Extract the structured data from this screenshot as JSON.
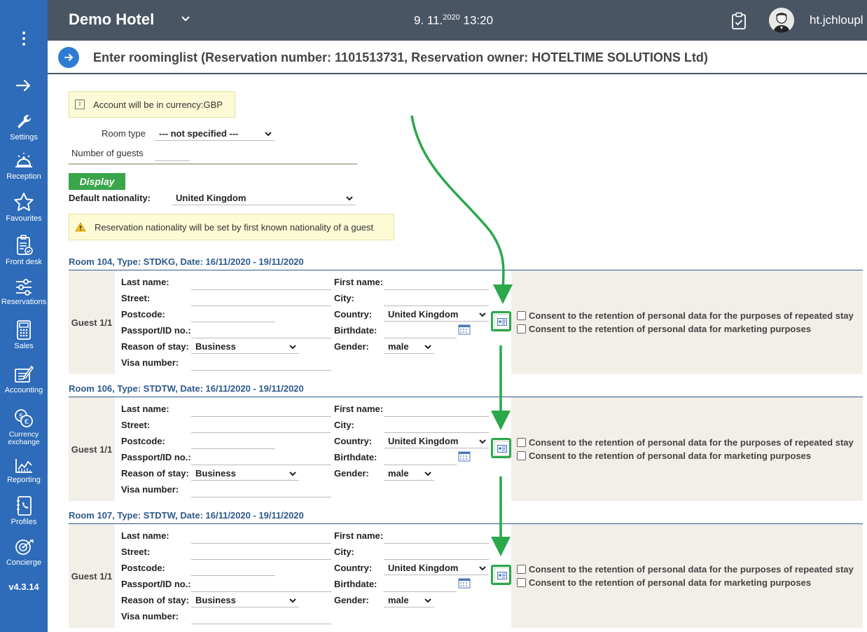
{
  "app": {
    "version": "v4.3.14"
  },
  "sidebar": {
    "items": [
      {
        "label": "Settings",
        "icon": "wrench-icon"
      },
      {
        "label": "Reception",
        "icon": "bell-icon"
      },
      {
        "label": "Favourites",
        "icon": "star-icon"
      },
      {
        "label": "Front desk",
        "icon": "clipboard-icon"
      },
      {
        "label": "Reservations",
        "icon": "sliders-icon"
      },
      {
        "label": "Sales",
        "icon": "calculator-icon"
      },
      {
        "label": "Accounting",
        "icon": "accounting-icon"
      },
      {
        "label": "Currency\nexchange",
        "icon": "currency-icon"
      },
      {
        "label": "Reporting",
        "icon": "chart-icon"
      },
      {
        "label": "Profiles",
        "icon": "phonebook-icon"
      },
      {
        "label": "Concierge",
        "icon": "concierge-icon"
      }
    ]
  },
  "header": {
    "hotel": "Demo Hotel",
    "date": "9. 11.",
    "year": "2020",
    "time": "13:20",
    "user": "ht.jchloupl"
  },
  "page": {
    "title": "Enter roominglist (Reservation number: 1101513731, Reservation owner: HOTELTIME SOLUTIONS Ltd)",
    "currency_note": "Account will be in currency:GBP",
    "room_type_label": "Room type",
    "room_type_value": "--- not specified ---",
    "guests_label": "Number of guests",
    "display_button": "Display",
    "default_nationality_label": "Default nationality:",
    "default_nationality_value": "United Kingdom",
    "nationality_warning": "Reservation nationality will be set by first known nationality of a guest"
  },
  "labels": {
    "last_name": "Last name:",
    "street": "Street:",
    "postcode": "Postcode:",
    "passport": "Passport/ID no.:",
    "reason": "Reason of stay:",
    "visa": "Visa number:",
    "first_name": "First name:",
    "city": "City:",
    "country": "Country:",
    "birthdate": "Birthdate:",
    "gender": "Gender:",
    "consent_repeated": "Consent to the retention of personal data for the purposes of repeated stay",
    "consent_marketing": "Consent to the retention of personal data for marketing purposes"
  },
  "rooms": [
    {
      "header": "Room 104, Type: STDKG, Date: 16/11/2020 - 19/11/2020",
      "guest": "Guest 1/1",
      "reason": "Business",
      "country": "United Kingdom",
      "gender": "male"
    },
    {
      "header": "Room 106, Type: STDTW, Date: 16/11/2020 - 19/11/2020",
      "guest": "Guest 1/1",
      "reason": "Business",
      "country": "United Kingdom",
      "gender": "male"
    },
    {
      "header": "Room 107, Type: STDTW, Date: 16/11/2020 - 19/11/2020",
      "guest": "Guest 1/1",
      "reason": "Business",
      "country": "United Kingdom",
      "gender": "male"
    }
  ],
  "colors": {
    "sidebar": "#2e6bb8",
    "topbar": "#4a5564",
    "accent_green": "#2aa84a",
    "display_button": "#3aa54a",
    "room_header": "#2e5a8c"
  }
}
